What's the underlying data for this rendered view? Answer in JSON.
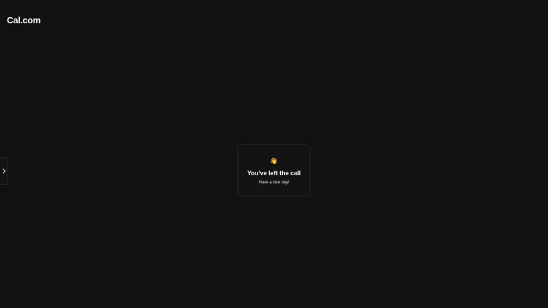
{
  "header": {
    "logo_text": "Cal.com"
  },
  "sidebar_toggle": {
    "icon": "chevron-right-icon"
  },
  "left_call_card": {
    "emoji": "👋",
    "title": "You've left the call",
    "subtitle": "Have a nice day!"
  },
  "colors": {
    "background": "#111111",
    "card_border": "#232323",
    "text": "#ffffff"
  }
}
